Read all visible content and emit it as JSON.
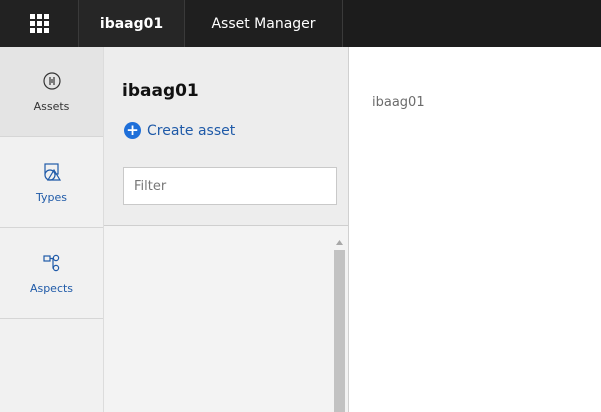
{
  "topbar": {
    "tenant": "ibaag01",
    "app_name": "Asset Manager"
  },
  "nav": {
    "items": [
      {
        "label": "Assets",
        "icon": "assets-icon",
        "active": true
      },
      {
        "label": "Types",
        "icon": "types-icon",
        "active": false
      },
      {
        "label": "Aspects",
        "icon": "aspects-icon",
        "active": false
      }
    ]
  },
  "panel": {
    "title": "ibaag01",
    "create_label": "Create asset",
    "filter_placeholder": "Filter"
  },
  "main": {
    "selected_asset": "ibaag01"
  },
  "colors": {
    "topbar": "#1c1c1c",
    "accent_blue": "#1e6fd9",
    "link_blue": "#1f5aa8"
  }
}
